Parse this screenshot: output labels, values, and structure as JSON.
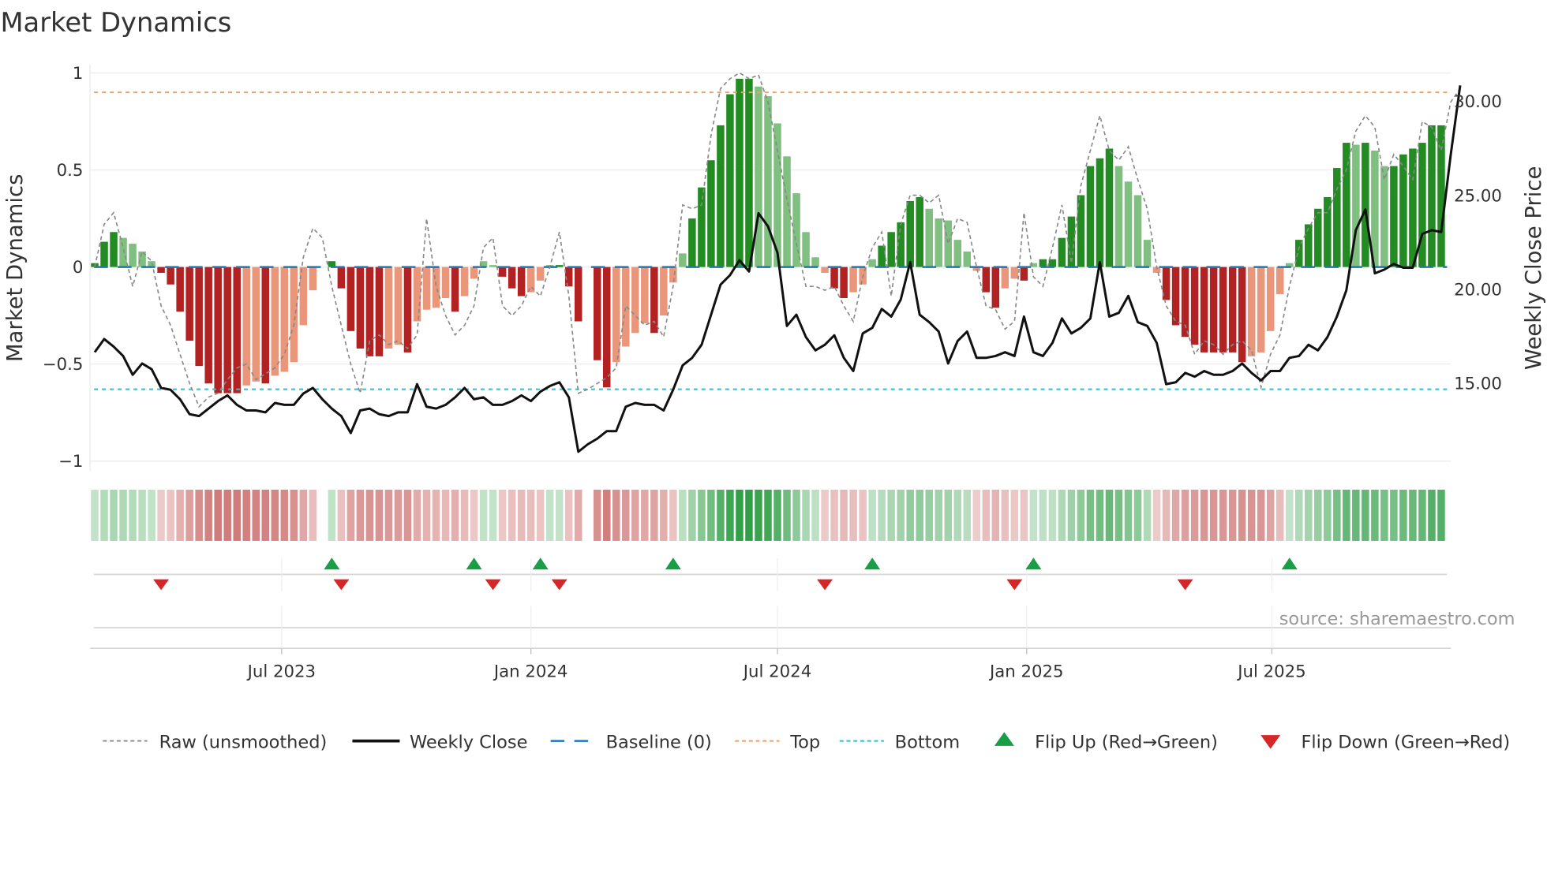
{
  "title": "Market Dynamics",
  "source": "source: sharemaestro.com",
  "chart_data": {
    "type": "bar",
    "title": "Market Dynamics",
    "ylabel_left": "Market Dynamics",
    "ylabel_right": "Weekly Close Price",
    "ylim_left": [
      -1,
      1
    ],
    "ylim_right": [
      10.5,
      31.5
    ],
    "left_ticks": [
      {
        "v": 1,
        "label": "1"
      },
      {
        "v": 0.5,
        "label": "0.5"
      },
      {
        "v": 0,
        "label": "0"
      },
      {
        "v": -0.5,
        "label": "−0.5"
      },
      {
        "v": -1,
        "label": "−1"
      }
    ],
    "right_ticks": [
      {
        "v": 30,
        "label": "30.00"
      },
      {
        "v": 25,
        "label": "25.00"
      },
      {
        "v": 20,
        "label": "20.00"
      },
      {
        "v": 15,
        "label": "15.00"
      }
    ],
    "x_ticks": [
      {
        "date": "2023-07-01",
        "label": "Jul 2023"
      },
      {
        "date": "2024-01-01",
        "label": "Jan 2024"
      },
      {
        "date": "2024-07-01",
        "label": "Jul 2024"
      },
      {
        "date": "2025-01-01",
        "label": "Jan 2025"
      },
      {
        "date": "2025-07-01",
        "label": "Jul 2025"
      }
    ],
    "start_week": "2023-02-13",
    "frequency": "weekly",
    "top_level": 0.9,
    "bottom_level": -0.63,
    "baseline": 0,
    "colors": {
      "up_strong": "#228b22",
      "up_weak": "#7fbf7f",
      "down_strong": "#b22222",
      "down_weak": "#e9967a",
      "raw": "#888888",
      "close": "#111111",
      "baseline": "#1f77b4",
      "top": "#f0a060",
      "bottom": "#22c5d5",
      "flip_up": "#1a9e45",
      "flip_down": "#d62728",
      "heat_green": "#2e9e44",
      "heat_red": "#c0504d"
    },
    "smoothed": [
      0.02,
      0.13,
      0.18,
      0.15,
      0.12,
      0.08,
      0.03,
      -0.03,
      -0.09,
      -0.23,
      -0.38,
      -0.51,
      -0.6,
      -0.65,
      -0.65,
      -0.65,
      -0.61,
      -0.59,
      -0.6,
      -0.56,
      -0.54,
      -0.49,
      -0.3,
      -0.12,
      0.0,
      0.03,
      -0.11,
      -0.33,
      -0.42,
      -0.46,
      -0.46,
      -0.42,
      -0.4,
      -0.44,
      -0.28,
      -0.22,
      -0.21,
      -0.16,
      -0.23,
      -0.15,
      -0.06,
      0.03,
      0.01,
      -0.05,
      -0.11,
      -0.15,
      -0.13,
      -0.07,
      0.01,
      0.01,
      -0.1,
      -0.28,
      0.0,
      -0.48,
      -0.62,
      -0.49,
      -0.41,
      -0.34,
      -0.29,
      -0.34,
      -0.25,
      -0.08,
      0.07,
      0.25,
      0.41,
      0.55,
      0.73,
      0.89,
      0.97,
      0.97,
      0.93,
      0.88,
      0.74,
      0.57,
      0.38,
      0.18,
      0.05,
      -0.03,
      -0.11,
      -0.16,
      -0.13,
      -0.09,
      0.04,
      0.11,
      0.18,
      0.23,
      0.34,
      0.36,
      0.3,
      0.25,
      0.24,
      0.14,
      0.08,
      -0.02,
      -0.13,
      -0.21,
      -0.11,
      -0.06,
      -0.07,
      0.02,
      0.04,
      0.04,
      0.15,
      0.26,
      0.37,
      0.52,
      0.56,
      0.61,
      0.52,
      0.44,
      0.37,
      0.14,
      -0.03,
      -0.17,
      -0.3,
      -0.36,
      -0.4,
      -0.44,
      -0.44,
      -0.44,
      -0.44,
      -0.49,
      -0.46,
      -0.44,
      -0.33,
      -0.14,
      0.02,
      0.14,
      0.22,
      0.3,
      0.36,
      0.51,
      0.64,
      0.63,
      0.64,
      0.6,
      0.52,
      0.52,
      0.58,
      0.61,
      0.64,
      0.73,
      0.73
    ],
    "raw": [
      0.0,
      0.22,
      0.28,
      0.1,
      -0.1,
      0.08,
      0.03,
      -0.2,
      -0.3,
      -0.45,
      -0.6,
      -0.72,
      -0.67,
      -0.65,
      -0.58,
      -0.52,
      -0.5,
      -0.58,
      -0.55,
      -0.52,
      -0.45,
      -0.3,
      0.05,
      0.2,
      0.15,
      -0.1,
      -0.3,
      -0.5,
      -0.65,
      -0.38,
      -0.35,
      -0.4,
      -0.38,
      -0.42,
      -0.35,
      0.25,
      -0.1,
      -0.25,
      -0.35,
      -0.3,
      -0.2,
      0.1,
      0.15,
      -0.2,
      -0.25,
      -0.2,
      -0.1,
      -0.15,
      0.0,
      0.18,
      -0.15,
      -0.65,
      -0.63,
      -0.6,
      -0.57,
      -0.52,
      -0.2,
      -0.25,
      -0.3,
      -0.28,
      -0.36,
      -0.1,
      0.32,
      0.3,
      0.32,
      0.68,
      0.92,
      0.97,
      1.0,
      0.97,
      0.99,
      0.85,
      0.6,
      0.35,
      0.12,
      -0.1,
      -0.1,
      -0.12,
      -0.1,
      -0.2,
      -0.28,
      -0.05,
      0.1,
      0.18,
      -0.15,
      0.22,
      0.37,
      0.37,
      0.33,
      0.37,
      0.12,
      0.25,
      0.23,
      0.0,
      -0.2,
      -0.22,
      -0.32,
      -0.28,
      0.28,
      -0.05,
      -0.1,
      0.1,
      0.32,
      0.02,
      0.42,
      0.6,
      0.78,
      0.6,
      0.55,
      0.62,
      0.45,
      0.3,
      0.0,
      -0.2,
      -0.28,
      -0.3,
      -0.45,
      -0.38,
      -0.4,
      -0.45,
      -0.4,
      -0.38,
      -0.43,
      -0.62,
      -0.45,
      -0.35,
      -0.1,
      0.1,
      0.2,
      0.28,
      0.28,
      0.4,
      0.5,
      0.7,
      0.78,
      0.72,
      0.45,
      0.58,
      0.52,
      0.45,
      0.75,
      0.72,
      0.6,
      0.85,
      0.92
    ],
    "close": [
      16.6,
      17.3,
      16.9,
      16.4,
      15.4,
      16.0,
      15.7,
      14.7,
      14.6,
      14.1,
      13.3,
      13.2,
      13.6,
      14.0,
      14.3,
      13.8,
      13.5,
      13.5,
      13.4,
      13.9,
      13.8,
      13.8,
      14.4,
      14.7,
      14.1,
      13.6,
      13.2,
      12.3,
      13.5,
      13.6,
      13.3,
      13.2,
      13.4,
      13.4,
      14.9,
      13.7,
      13.6,
      13.8,
      14.2,
      14.7,
      14.1,
      14.2,
      13.8,
      13.8,
      14.0,
      14.3,
      14.0,
      14.5,
      14.8,
      15.0,
      14.2,
      11.3,
      11.7,
      12.0,
      12.4,
      12.4,
      13.7,
      13.9,
      13.8,
      13.8,
      13.5,
      14.6,
      15.9,
      16.3,
      17.0,
      18.6,
      20.2,
      20.7,
      21.5,
      20.9,
      24.0,
      23.3,
      21.9,
      18.0,
      18.6,
      17.4,
      16.7,
      17.0,
      17.5,
      16.3,
      15.6,
      17.6,
      17.9,
      18.9,
      18.5,
      19.4,
      21.4,
      18.6,
      18.2,
      17.7,
      16.0,
      17.2,
      17.7,
      16.3,
      16.3,
      16.4,
      16.6,
      16.4,
      18.5,
      16.6,
      16.4,
      17.1,
      18.4,
      17.6,
      17.9,
      18.4,
      21.4,
      18.5,
      18.7,
      19.6,
      18.2,
      18.0,
      17.1,
      14.9,
      15.0,
      15.5,
      15.3,
      15.6,
      15.4,
      15.4,
      15.6,
      16.0,
      15.5,
      15.1,
      15.6,
      15.6,
      16.3,
      16.4,
      17.0,
      16.7,
      17.4,
      18.5,
      19.9,
      23.1,
      24.2,
      20.8,
      21.0,
      21.3,
      21.1,
      21.1,
      22.9,
      23.1,
      23.0,
      27.1,
      30.8
    ],
    "flip_up": [
      "2023-08-07",
      "2023-11-20",
      "2024-01-08",
      "2024-04-15",
      "2024-09-09",
      "2025-01-06",
      "2025-07-14"
    ],
    "flip_down": [
      "2023-04-03",
      "2023-08-14",
      "2023-12-04",
      "2024-01-22",
      "2024-08-05",
      "2024-12-23",
      "2025-04-28"
    ],
    "legend": [
      {
        "key": "raw",
        "label": "Raw (unsmoothed)"
      },
      {
        "key": "close",
        "label": "Weekly Close"
      },
      {
        "key": "baseline",
        "label": "Baseline (0)"
      },
      {
        "key": "top",
        "label": "Top"
      },
      {
        "key": "bottom",
        "label": "Bottom"
      },
      {
        "key": "flip_up",
        "label": "Flip Up (Red→Green)"
      },
      {
        "key": "flip_down",
        "label": "Flip Down (Green→Red)"
      }
    ],
    "legend_position": "bottom"
  }
}
